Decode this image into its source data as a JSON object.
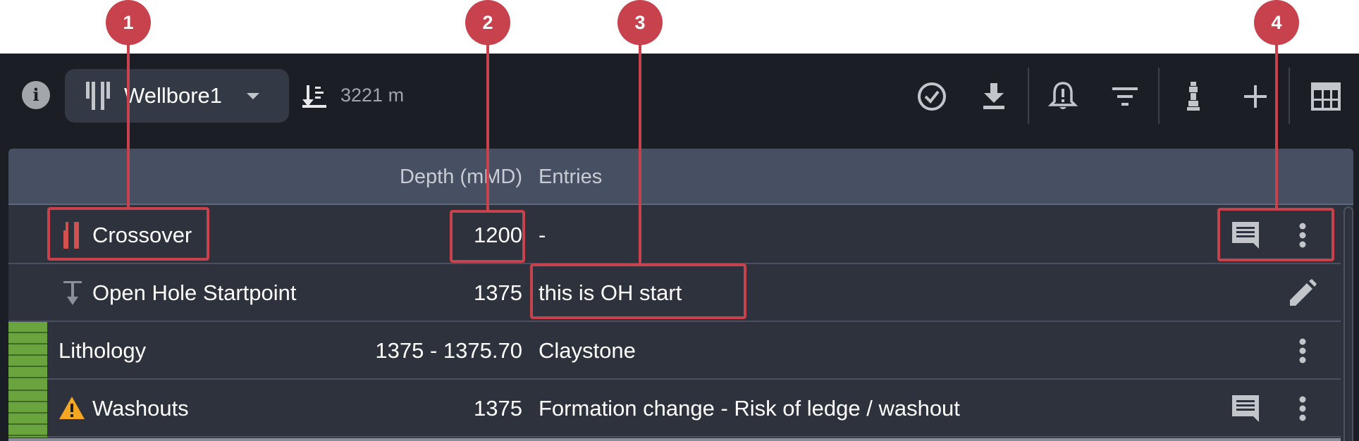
{
  "toolbar": {
    "wellbore_name": "Wellbore1",
    "depth_value": "3221 m",
    "icons": [
      "info-icon",
      "wellbore-icon",
      "chevron-down-icon",
      "depth-icon",
      "check-circle-icon",
      "download-icon",
      "alarm-bell-icon",
      "filter-icon",
      "casing-icon",
      "add-icon",
      "table-icon"
    ]
  },
  "table": {
    "headers": {
      "depth": "Depth (mMD)",
      "entries": "Entries"
    },
    "rows": [
      {
        "name": "Crossover",
        "depth": "1200",
        "entry": "-",
        "icon": "crossover-icon",
        "actions": [
          "comment-icon",
          "more-vert-icon"
        ]
      },
      {
        "name": "Open Hole Startpoint",
        "depth": "1375",
        "entry": "this is OH start",
        "icon": "open-hole-icon",
        "actions": [
          "edit-icon"
        ]
      },
      {
        "name": "Lithology",
        "depth": "1375 - 1375.70",
        "entry": "Claystone",
        "icon": "claystone-pattern",
        "actions": [
          "more-vert-icon"
        ]
      },
      {
        "name": "Washouts",
        "depth": "1375",
        "entry": "Formation change - Risk of ledge / washout",
        "icon": "warning-icon",
        "actions": [
          "comment-icon",
          "more-vert-icon"
        ]
      }
    ]
  },
  "callouts": [
    "1",
    "2",
    "3",
    "4"
  ],
  "colors": {
    "background": "#1b1e24",
    "panel": "#343a45",
    "table_body": "#2e323d",
    "table_header": "#475063",
    "callout": "#c8424e",
    "crossover_icon": "#d2504e",
    "warning": "#f5a623",
    "claystone": "#6aa43e"
  }
}
